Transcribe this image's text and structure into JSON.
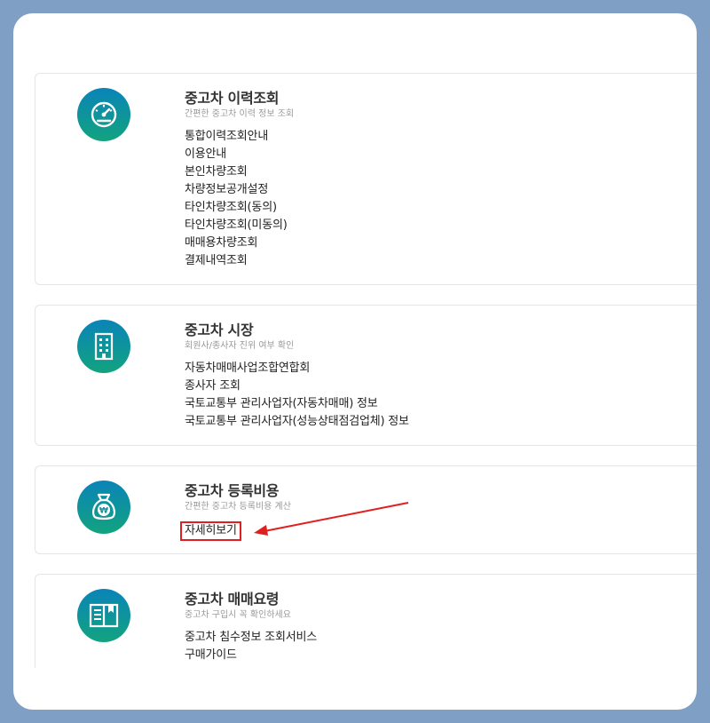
{
  "sections": [
    {
      "title": "중고차 이력조회",
      "subtitle": "간편한 중고차 이력 정보 조회",
      "icon": "speedometer-icon",
      "links": [
        "통합이력조회안내",
        "이용안내",
        "본인차량조회",
        "차량정보공개설정",
        "타인차량조회(동의)",
        "타인차량조회(미동의)",
        "매매용차량조회",
        "결제내역조회"
      ]
    },
    {
      "title": "중고차 시장",
      "subtitle": "회원사/종사자 진위 여부 확인",
      "icon": "building-icon",
      "links": [
        "자동차매매사업조합연합회",
        "종사자 조회",
        "국토교통부 관리사업자(자동차매매) 정보",
        "국토교통부 관리사업자(성능상태점검업체) 정보"
      ]
    },
    {
      "title": "중고차 등록비용",
      "subtitle": "간편한 중고차 등록비용 계산",
      "icon": "money-bag-icon",
      "links": [
        "자세히보기"
      ]
    },
    {
      "title": "중고차 매매요령",
      "subtitle": "중고차 구입시 꼭 확인하세요",
      "icon": "book-icon",
      "links": [
        "중고차 침수정보 조회서비스",
        "구매가이드"
      ]
    }
  ],
  "colors": {
    "background": "#7f9fc4",
    "icon_gradient_top": "#0a84b8",
    "icon_gradient_bottom": "#12a37f",
    "highlight": "#e02020"
  }
}
